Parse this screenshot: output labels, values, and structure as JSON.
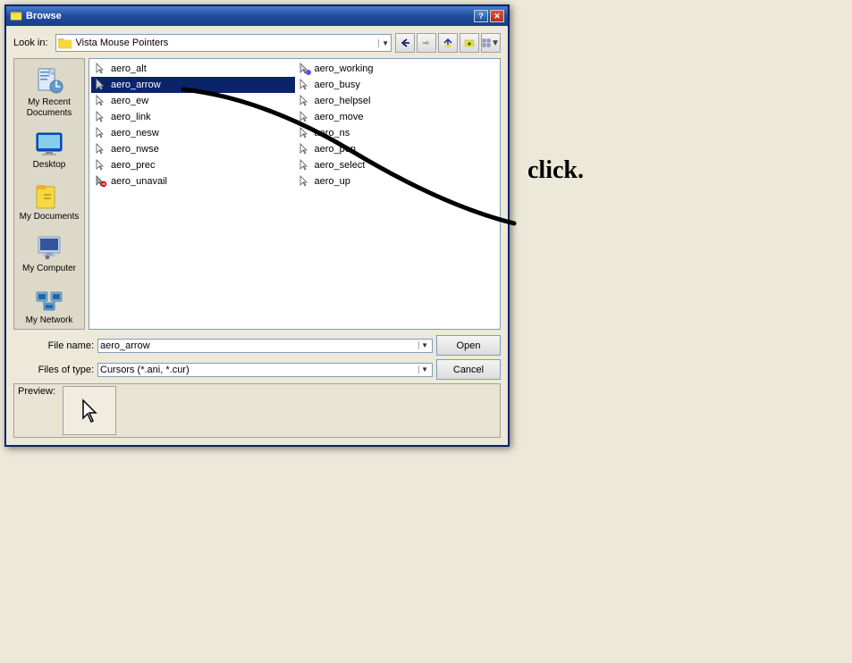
{
  "window": {
    "title": "Browse",
    "look_in_label": "Look in:",
    "folder_name": "Vista Mouse Pointers",
    "file_name_label": "File name:",
    "file_name_value": "aero_arrow",
    "files_of_type_label": "Files of type:",
    "files_of_type_value": "Cursors (*.ani, *.cur)",
    "open_button": "Open",
    "cancel_button": "Cancel",
    "preview_label": "Preview:"
  },
  "sidebar": {
    "items": [
      {
        "id": "recent",
        "label": "My Recent\nDocuments",
        "icon": "recent-docs"
      },
      {
        "id": "desktop",
        "label": "Desktop",
        "icon": "desktop"
      },
      {
        "id": "documents",
        "label": "My Documents",
        "icon": "my-docs"
      },
      {
        "id": "computer",
        "label": "My Computer",
        "icon": "my-computer"
      },
      {
        "id": "network",
        "label": "My Network",
        "icon": "my-network"
      }
    ]
  },
  "files": [
    {
      "name": "aero_alt",
      "type": "cursor",
      "selected": false
    },
    {
      "name": "aero_working",
      "type": "animated",
      "selected": false
    },
    {
      "name": "aero_arrow",
      "type": "cursor",
      "selected": true
    },
    {
      "name": "aero_busy",
      "type": "cursor",
      "selected": false
    },
    {
      "name": "aero_ew",
      "type": "cursor",
      "selected": false
    },
    {
      "name": "aero_helpsel",
      "type": "cursor",
      "selected": false
    },
    {
      "name": "aero_link",
      "type": "cursor",
      "selected": false
    },
    {
      "name": "aero_move",
      "type": "cursor",
      "selected": false
    },
    {
      "name": "aero_nesw",
      "type": "cursor",
      "selected": false
    },
    {
      "name": "aero_ns",
      "type": "cursor",
      "selected": false
    },
    {
      "name": "aero_nwse",
      "type": "cursor",
      "selected": false
    },
    {
      "name": "aero_pen",
      "type": "cursor",
      "selected": false
    },
    {
      "name": "aero_prec",
      "type": "cursor",
      "selected": false
    },
    {
      "name": "aero_select",
      "type": "cursor",
      "selected": false
    },
    {
      "name": "aero_unavail",
      "type": "cursor-unavail",
      "selected": false
    },
    {
      "name": "aero_up",
      "type": "cursor",
      "selected": false
    }
  ],
  "annotation": {
    "click_text": "click."
  },
  "colors": {
    "title_bar_start": "#4a7fcb",
    "title_bar_end": "#1a3e8c",
    "selected_bg": "#0a246a",
    "border": "#7f9db9"
  }
}
